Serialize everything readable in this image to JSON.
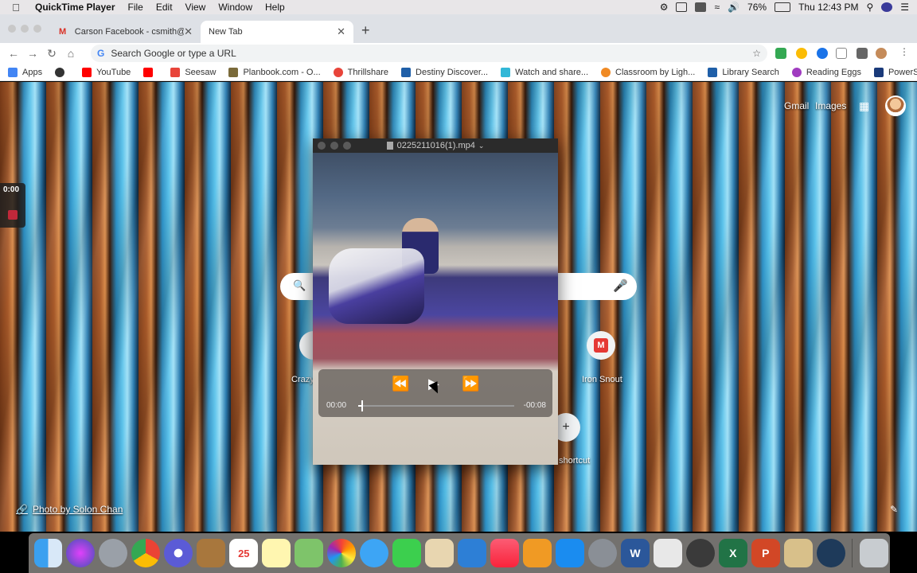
{
  "menubar": {
    "app_name": "QuickTime Player",
    "menus": [
      "File",
      "Edit",
      "View",
      "Window",
      "Help"
    ],
    "battery": "76%",
    "clock": "Thu 12:43 PM"
  },
  "browser": {
    "tabs": [
      {
        "title": "Carson Facebook - csmith@us",
        "active": false
      },
      {
        "title": "New Tab",
        "active": true
      }
    ],
    "omnibox_placeholder": "Search Google or type a URL",
    "bookmarks": [
      {
        "label": "Apps",
        "color": "#4285f4"
      },
      {
        "label": "",
        "color": "#333333"
      },
      {
        "label": "YouTube",
        "color": "#ff0000"
      },
      {
        "label": "",
        "color": "#ff0000"
      },
      {
        "label": "Seesaw",
        "color": "#e8443a"
      },
      {
        "label": "Planbook.com - O...",
        "color": "#7a6a3a"
      },
      {
        "label": "Thrillshare",
        "color": "#e8443a"
      },
      {
        "label": "Destiny Discover...",
        "color": "#1f5fa8"
      },
      {
        "label": "Watch and share...",
        "color": "#31b7d7"
      },
      {
        "label": "Classroom by Ligh...",
        "color": "#f08a24"
      },
      {
        "label": "Library Search",
        "color": "#1f5fa8"
      },
      {
        "label": "Reading Eggs",
        "color": "#a03cc0"
      },
      {
        "label": "PowerSchool",
        "color": "#1a3a7a"
      }
    ]
  },
  "ntp": {
    "gmail": "Gmail",
    "images": "Images",
    "shortcuts": [
      {
        "label": "Crazy"
      },
      {
        "label": "Iron Snout"
      },
      {
        "label": "shortcut"
      }
    ],
    "photo_credit": "Photo by Solon Chan"
  },
  "recorder": {
    "time": "0:00"
  },
  "quicktime": {
    "filename": "0225211016(1).mp4",
    "time_current": "00:00",
    "time_remaining": "-00:08",
    "progress_fraction": 0.02
  }
}
